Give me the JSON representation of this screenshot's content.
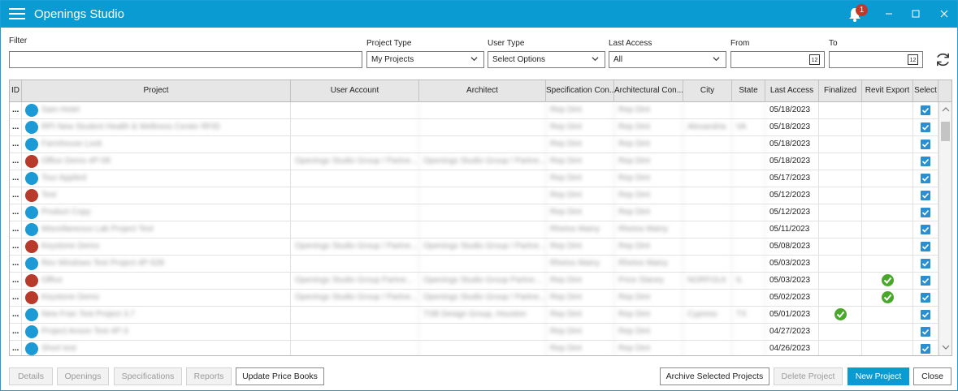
{
  "app": {
    "title": "Openings Studio",
    "notification_count": "1"
  },
  "filters": {
    "filter_label": "Filter",
    "filter_value": "",
    "project_type_label": "Project Type",
    "project_type_value": "My Projects",
    "user_type_label": "User Type",
    "user_type_value": "Select Options",
    "last_access_label": "Last Access",
    "last_access_value": "All",
    "from_label": "From",
    "from_value": "",
    "to_label": "To",
    "to_value": ""
  },
  "grid": {
    "columns": [
      "ID",
      "Project",
      "User Account",
      "Architect",
      "Specification Con...",
      "Architectural Con...",
      "City",
      "State",
      "Last Access",
      "Finalized",
      "Revit Export",
      "Select"
    ],
    "rows": [
      {
        "icon": "blue",
        "project": "Sam Hotel",
        "user": "",
        "architect": "",
        "spec": "Rep Dint",
        "arch": "Rep Dint",
        "city": "",
        "state": "",
        "last_access": "05/18/2023",
        "finalized": false,
        "revit": false,
        "selected": true
      },
      {
        "icon": "blue",
        "project": "RPI New Student Health & Wellness Center RFID",
        "user": "",
        "architect": "",
        "spec": "Rep Dint",
        "arch": "Rep Dint",
        "city": "Alexandria",
        "state": "VA",
        "last_access": "05/18/2023",
        "finalized": false,
        "revit": false,
        "selected": true
      },
      {
        "icon": "blue",
        "project": "Farmhouse Lock",
        "user": "",
        "architect": "",
        "spec": "Rep Dint",
        "arch": "Rep Dint",
        "city": "",
        "state": "",
        "last_access": "05/18/2023",
        "finalized": false,
        "revit": false,
        "selected": true
      },
      {
        "icon": "red",
        "project": "Office Demo 4P-08",
        "user": "Openings Studio Group / Partne...",
        "architect": "Openings Studio Group / Partne...",
        "spec": "Rep Dint",
        "arch": "Rep Dint",
        "city": "",
        "state": "",
        "last_access": "05/18/2023",
        "finalized": false,
        "revit": false,
        "selected": true
      },
      {
        "icon": "blue",
        "project": "Tour Applied",
        "user": "",
        "architect": "",
        "spec": "Rep Dint",
        "arch": "Rep Dint",
        "city": "",
        "state": "",
        "last_access": "05/17/2023",
        "finalized": false,
        "revit": false,
        "selected": true
      },
      {
        "icon": "red",
        "project": "Test",
        "user": "",
        "architect": "",
        "spec": "Rep Dint",
        "arch": "Rep Dint",
        "city": "",
        "state": "",
        "last_access": "05/12/2023",
        "finalized": false,
        "revit": false,
        "selected": true
      },
      {
        "icon": "blue",
        "project": "Product Copy",
        "user": "",
        "architect": "",
        "spec": "Rep Dint",
        "arch": "Rep Dint",
        "city": "",
        "state": "",
        "last_access": "05/12/2023",
        "finalized": false,
        "revit": false,
        "selected": true
      },
      {
        "icon": "blue",
        "project": "Miscellaneous Lab Project Test",
        "user": "",
        "architect": "",
        "spec": "Rhetos Mainy",
        "arch": "Rhetos Mainy",
        "city": "",
        "state": "",
        "last_access": "05/11/2023",
        "finalized": false,
        "revit": false,
        "selected": true
      },
      {
        "icon": "red",
        "project": "Keystone Demo",
        "user": "Openings Studio Group / Partne...",
        "architect": "Openings Studio Group / Partne...",
        "spec": "Rep Dint",
        "arch": "Rep Dint",
        "city": "",
        "state": "",
        "last_access": "05/08/2023",
        "finalized": false,
        "revit": false,
        "selected": true
      },
      {
        "icon": "blue",
        "project": "Rev Windows Test Project 4P-528",
        "user": "",
        "architect": "",
        "spec": "Rhetos Mainy",
        "arch": "Rhetos Mainy",
        "city": "",
        "state": "",
        "last_access": "05/03/2023",
        "finalized": false,
        "revit": false,
        "selected": true
      },
      {
        "icon": "red",
        "project": "Office",
        "user": "Openings Studio Group Partne...",
        "architect": "Openings Studio Group Partne...",
        "spec": "Rep Dint",
        "arch": "Price Slaney",
        "city": "NORFOLK",
        "state": "IL",
        "last_access": "05/03/2023",
        "finalized": false,
        "revit": true,
        "selected": true
      },
      {
        "icon": "red",
        "project": "Keystone Demo",
        "user": "Openings Studio Group / Partne...",
        "architect": "Openings Studio Group / Partne...",
        "spec": "Rep Dint",
        "arch": "Rep Dint",
        "city": "",
        "state": "",
        "last_access": "05/02/2023",
        "finalized": false,
        "revit": true,
        "selected": true
      },
      {
        "icon": "blue",
        "project": "New Fran Test Project 3.7",
        "user": "",
        "architect": "TSB Design Group, Houston",
        "spec": "Rep Dint",
        "arch": "Rep Dint",
        "city": "Cypress",
        "state": "TX",
        "last_access": "05/01/2023",
        "finalized": true,
        "revit": false,
        "selected": true
      },
      {
        "icon": "blue",
        "project": "Project Anson Test 4P-3",
        "user": "",
        "architect": "",
        "spec": "Rep Dint",
        "arch": "Rep Dint",
        "city": "",
        "state": "",
        "last_access": "04/27/2023",
        "finalized": false,
        "revit": false,
        "selected": true
      },
      {
        "icon": "blue",
        "project": "Short test",
        "user": "",
        "architect": "",
        "spec": "Rep Dint",
        "arch": "Rep Dint",
        "city": "",
        "state": "",
        "last_access": "04/26/2023",
        "finalized": false,
        "revit": false,
        "selected": true
      }
    ]
  },
  "buttons": {
    "details": "Details",
    "openings": "Openings",
    "specifications": "Specifications",
    "reports": "Reports",
    "update_price_books": "Update Price Books",
    "archive_selected": "Archive Selected Projects",
    "delete_project": "Delete Project",
    "new_project": "New Project",
    "close": "Close"
  },
  "colors": {
    "accent": "#0a9bd3",
    "check": "#2a8fd0",
    "green": "#49a82b",
    "red_icon": "#b83a2a"
  }
}
